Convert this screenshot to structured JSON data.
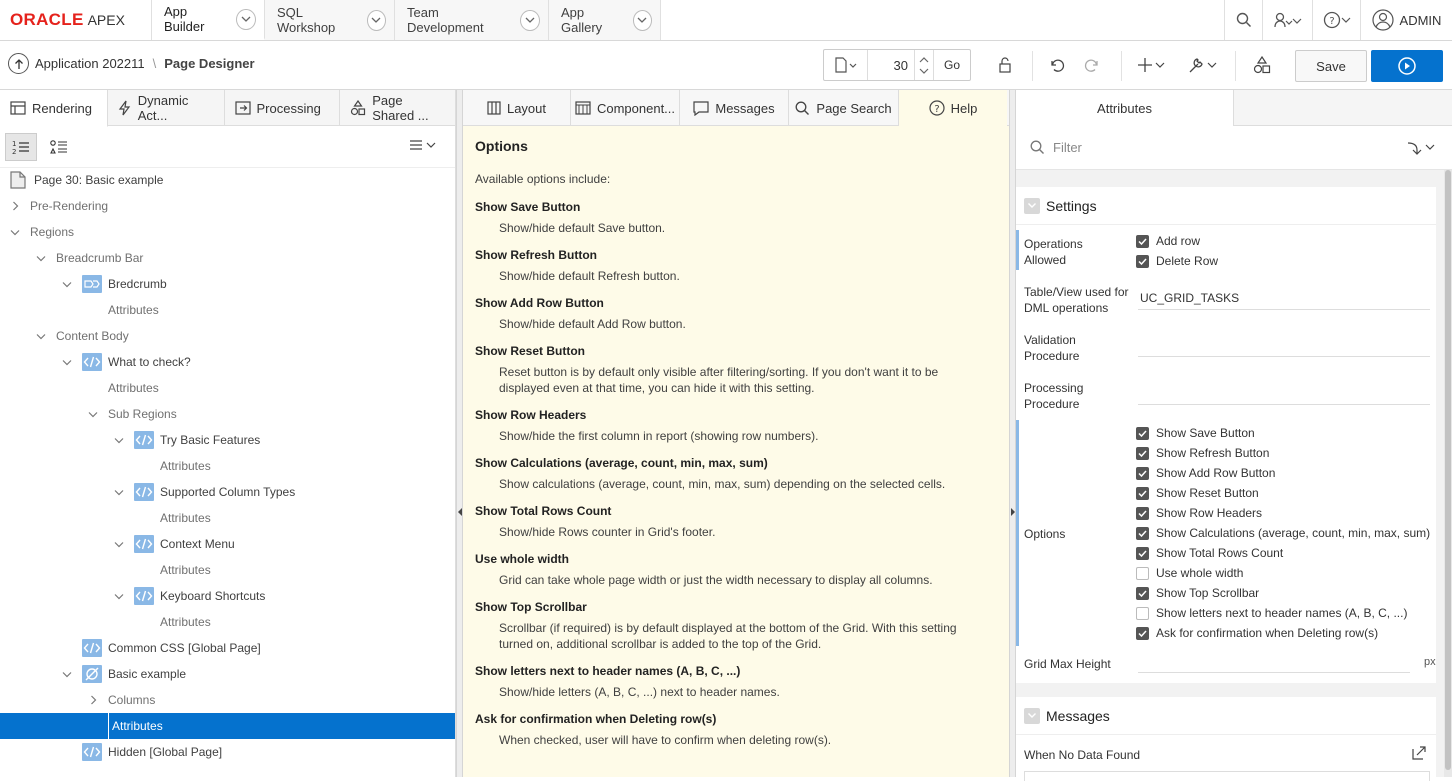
{
  "topnav": {
    "logo_oracle": "ORACLE",
    "logo_apex": "APEX",
    "tabs": [
      {
        "label": "App Builder",
        "active": true
      },
      {
        "label": "SQL Workshop",
        "active": false
      },
      {
        "label": "Team Development",
        "active": false
      },
      {
        "label": "App Gallery",
        "active": false
      }
    ],
    "user": "ADMIN"
  },
  "toolbar": {
    "app_label": "Application 202211",
    "page_designer": "Page Designer",
    "page_number": "30",
    "go_label": "Go",
    "save_label": "Save"
  },
  "left": {
    "tabs": [
      {
        "label": "Rendering",
        "icon": "rendering-icon"
      },
      {
        "label": "Dynamic Act...",
        "icon": "lightning-icon"
      },
      {
        "label": "Processing",
        "icon": "processing-icon"
      },
      {
        "label": "Page Shared ...",
        "icon": "shapes-icon"
      }
    ],
    "tree": [
      {
        "label": "Page 30: Basic example",
        "level": 0,
        "chev": "none",
        "icon": "page-icon"
      },
      {
        "label": "Pre-Rendering",
        "level": 0,
        "chev": "right",
        "icon": "none"
      },
      {
        "label": "Regions",
        "level": 0,
        "chev": "down",
        "icon": "none"
      },
      {
        "label": "Breadcrumb Bar",
        "level": 1,
        "chev": "down",
        "icon": "none"
      },
      {
        "label": "Bredcrumb",
        "level": 2,
        "chev": "down",
        "icon": "breadcrumb-icon"
      },
      {
        "label": "Attributes",
        "level": 3,
        "chev": "none",
        "icon": "none"
      },
      {
        "label": "Content Body",
        "level": 1,
        "chev": "down",
        "icon": "none"
      },
      {
        "label": "What to check?",
        "level": 2,
        "chev": "down",
        "icon": "code-icon"
      },
      {
        "label": "Attributes",
        "level": 3,
        "chev": "none",
        "icon": "none"
      },
      {
        "label": "Sub Regions",
        "level": 3,
        "chev": "down",
        "icon": "none"
      },
      {
        "label": "Try Basic Features",
        "level": 4,
        "chev": "down",
        "icon": "code-icon"
      },
      {
        "label": "Attributes",
        "level": 5,
        "chev": "none",
        "icon": "none"
      },
      {
        "label": "Supported Column Types",
        "level": 4,
        "chev": "down",
        "icon": "code-icon"
      },
      {
        "label": "Attributes",
        "level": 5,
        "chev": "none",
        "icon": "none"
      },
      {
        "label": "Context Menu",
        "level": 4,
        "chev": "down",
        "icon": "code-icon"
      },
      {
        "label": "Attributes",
        "level": 5,
        "chev": "none",
        "icon": "none"
      },
      {
        "label": "Keyboard Shortcuts",
        "level": 4,
        "chev": "down",
        "icon": "code-icon"
      },
      {
        "label": "Attributes",
        "level": 5,
        "chev": "none",
        "icon": "none"
      },
      {
        "label": "Common CSS [Global Page]",
        "level": 2,
        "chev": "none",
        "icon": "code-icon"
      },
      {
        "label": "Basic example",
        "level": 2,
        "chev": "down",
        "icon": "plugin-icon"
      },
      {
        "label": "Columns",
        "level": 3,
        "chev": "right",
        "icon": "none"
      },
      {
        "label": "Attributes",
        "level": 3,
        "chev": "none",
        "icon": "none",
        "selected": true
      },
      {
        "label": "Hidden [Global Page]",
        "level": 2,
        "chev": "none",
        "icon": "code-icon"
      }
    ]
  },
  "center": {
    "tabs": [
      {
        "label": "Layout",
        "icon": "layout-icon"
      },
      {
        "label": "Component...",
        "icon": "component-icon"
      },
      {
        "label": "Messages",
        "icon": "messages-icon"
      },
      {
        "label": "Page Search",
        "icon": "search-icon"
      },
      {
        "label": "Help",
        "icon": "help-icon"
      }
    ],
    "help_title": "Options",
    "help_intro": "Available options include:",
    "options": [
      {
        "title": "Show Save Button",
        "desc": "Show/hide default Save button."
      },
      {
        "title": "Show Refresh Button",
        "desc": "Show/hide default Refresh button."
      },
      {
        "title": "Show Add Row Button",
        "desc": "Show/hide default Add Row button."
      },
      {
        "title": "Show Reset Button",
        "desc": "Reset button is by default only visible after filtering/sorting. If you don't want it to be displayed even at that time, you can hide it with this setting."
      },
      {
        "title": "Show Row Headers",
        "desc": "Show/hide the first column in report (showing row numbers)."
      },
      {
        "title": "Show Calculations (average, count, min, max, sum)",
        "desc": "Show calculations (average, count, min, max, sum) depending on the selected cells."
      },
      {
        "title": "Show Total Rows Count",
        "desc": "Show/hide Rows counter in Grid's footer."
      },
      {
        "title": "Use whole width",
        "desc": "Grid can take whole page width or just the width necessary to display all columns."
      },
      {
        "title": "Show Top Scrollbar",
        "desc": "Scrollbar (if required) is by default displayed at the bottom of the Grid. With this setting turned on, additional scrollbar is added to the top of the Grid."
      },
      {
        "title": "Show letters next to header names (A, B, C, ...)",
        "desc": "Show/hide letters (A, B, C, ...) next to header names."
      },
      {
        "title": "Ask for confirmation when Deleting row(s)",
        "desc": "When checked, user will have to confirm when deleting row(s)."
      }
    ]
  },
  "right": {
    "tab": "Attributes",
    "filter_placeholder": "Filter",
    "settings": {
      "title": "Settings",
      "operations_label": "Operations Allowed",
      "operations": [
        {
          "label": "Add row",
          "checked": true
        },
        {
          "label": "Delete Row",
          "checked": true
        }
      ],
      "table_label": "Table/View used for DML operations",
      "table_value": "UC_GRID_TASKS",
      "validation_label": "Validation Procedure",
      "processing_label": "Processing Procedure",
      "options_label": "Options",
      "options": [
        {
          "label": "Show Save Button",
          "checked": true
        },
        {
          "label": "Show Refresh Button",
          "checked": true
        },
        {
          "label": "Show Add Row Button",
          "checked": true
        },
        {
          "label": "Show Reset Button",
          "checked": true
        },
        {
          "label": "Show Row Headers",
          "checked": true
        },
        {
          "label": "Show Calculations (average, count, min, max, sum)",
          "checked": true
        },
        {
          "label": "Show Total Rows Count",
          "checked": true
        },
        {
          "label": "Use whole width",
          "checked": false
        },
        {
          "label": "Show Top Scrollbar",
          "checked": true
        },
        {
          "label": "Show letters next to header names (A, B, C, ...)",
          "checked": false
        },
        {
          "label": "Ask for confirmation when Deleting row(s)",
          "checked": true
        }
      ],
      "grid_height_label": "Grid Max Height",
      "grid_height_unit": "px"
    },
    "messages": {
      "title": "Messages",
      "no_data_label": "When No Data Found"
    }
  },
  "colors": {
    "accent": "#0572ce",
    "oracle_red": "#e5221c",
    "help_bg": "#fefbe8",
    "icon_blue": "#8ab8e6"
  }
}
